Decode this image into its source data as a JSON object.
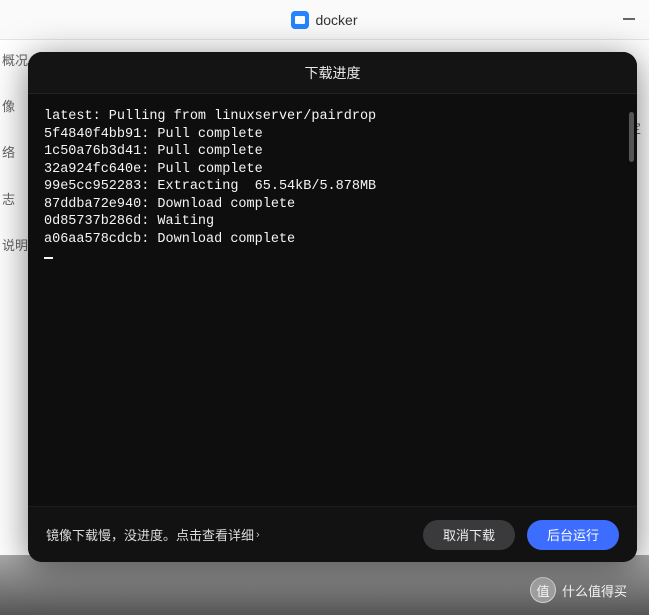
{
  "window": {
    "title": "docker",
    "sidebar_fragments": [
      "概况",
      "像",
      "络",
      "志",
      "说明"
    ],
    "right_label": "自定"
  },
  "modal": {
    "title": "下载进度",
    "footer_link": "镜像下载慢，没进度。点击查看详细",
    "footer_link_chev": "›",
    "cancel_label": "取消下载",
    "background_label": "后台运行"
  },
  "terminal": {
    "lines": [
      "latest: Pulling from linuxserver/pairdrop",
      "5f4840f4bb91: Pull complete",
      "1c50a76b3d41: Pull complete",
      "32a924fc640e: Pull complete",
      "99e5cc952283: Extracting  65.54kB/5.878MB",
      "87ddba72e940: Download complete",
      "0d85737b286d: Waiting",
      "a06aa578cdcb: Download complete"
    ]
  },
  "watermark": {
    "circle": "值",
    "text": "什么值得买"
  }
}
